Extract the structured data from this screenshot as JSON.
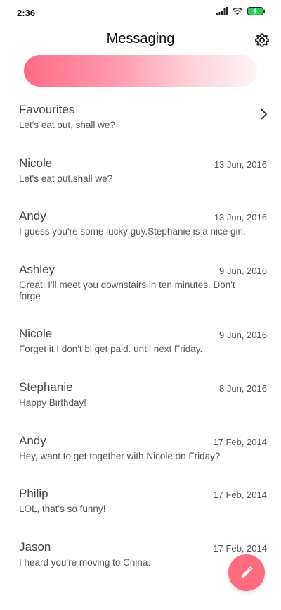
{
  "status_bar": {
    "time": "2:36"
  },
  "header": {
    "title": "Messaging"
  },
  "favourites": {
    "name": "Favourites",
    "preview": "Let's eat out, shall we?"
  },
  "conversations": [
    {
      "name": "Nicole",
      "date": "13 Jun, 2016",
      "preview": "Let's eat out,shall we?"
    },
    {
      "name": "Andy",
      "date": "13 Jun, 2016",
      "preview": "I guess you're some lucky guy.Stephanie is a nice girl."
    },
    {
      "name": "Ashley",
      "date": "9 Jun, 2016",
      "preview": "Great! I'll meet you downstairs in ten minutes. Don't forge"
    },
    {
      "name": "Nicole",
      "date": "9 Jun, 2016",
      "preview": "Forget it.I don't bl get paid. until next Friday."
    },
    {
      "name": "Stephanie",
      "date": "8 Jun, 2016",
      "preview": "Happy Birthday!"
    },
    {
      "name": "Andy",
      "date": "17 Feb, 2014",
      "preview": "Hey, want to get together with Nicole on Friday?"
    },
    {
      "name": "Philip",
      "date": "17 Feb, 2014",
      "preview": "LOL, that's so funny!"
    },
    {
      "name": "Jason",
      "date": "17 Feb, 2014",
      "preview": "I heard you're moving to China."
    }
  ],
  "icons": {
    "settings": "gear-icon",
    "favourites_arrow": "chevron-right-icon",
    "compose": "pencil-icon"
  },
  "colors": {
    "accent": "#ff6b7f",
    "banner_start": "#ff6b86",
    "banner_end": "#fff4f6",
    "battery": "#34c759"
  }
}
